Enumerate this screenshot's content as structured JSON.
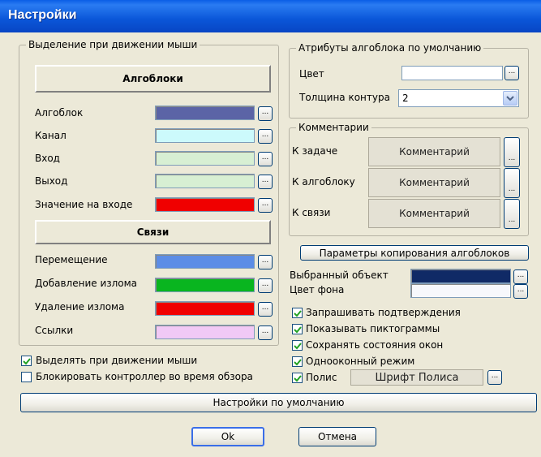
{
  "window": {
    "title": "Настройки"
  },
  "mouse_group": {
    "legend": "Выделение при движении мыши",
    "algoblocks_header": "Алгоблоки",
    "algoblock_items": [
      {
        "label": "Алгоблок",
        "color": "#5b64a6"
      },
      {
        "label": "Канал",
        "color": "#ccfafc"
      },
      {
        "label": "Вход",
        "color": "#d7efd3"
      },
      {
        "label": "Выход",
        "color": "#d7efd3"
      },
      {
        "label": "Значение на входе",
        "color": "#f00000"
      }
    ],
    "links_header": "Связи",
    "link_items": [
      {
        "label": "Перемещение",
        "color": "#5c8de6"
      },
      {
        "label": "Добавление излома",
        "color": "#09b51f"
      },
      {
        "label": "Удаление излома",
        "color": "#f00000"
      },
      {
        "label": "Ссылки",
        "color": "#f1c9f6"
      }
    ]
  },
  "attributes": {
    "legend": "Атрибуты алгоблока по умолчанию",
    "color_label": "Цвет",
    "thickness_label": "Толщина контура",
    "thickness_value": "2"
  },
  "comments": {
    "legend": "Комментарии",
    "items": [
      {
        "label": "К задаче",
        "button": "Комментарий"
      },
      {
        "label": "К алгоблоку",
        "button": "Комментарий"
      },
      {
        "label": "К связи",
        "button": "Комментарий"
      }
    ]
  },
  "copy_params_button": "Параметры копирования алгоблоков",
  "selected_object": {
    "label": "Выбранный объект",
    "color": "#102a66"
  },
  "bg_color": {
    "label": "Цвет фона",
    "color": "#f7f8fc"
  },
  "right_checkboxes": [
    {
      "label": "Запрашивать подтверждения",
      "checked": true
    },
    {
      "label": "Показывать пиктограммы",
      "checked": true
    },
    {
      "label": "Сохранять состояния окон",
      "checked": true
    },
    {
      "label": "Однооконный режим",
      "checked": true
    }
  ],
  "polis": {
    "label": "Полис",
    "checked": true,
    "font_button": "Шрифт Полиса"
  },
  "left_checkboxes": [
    {
      "label": "Выделять при движении мыши",
      "checked": true
    },
    {
      "label": "Блокировать контроллер во время обзора",
      "checked": false
    }
  ],
  "defaults_button": "Настройки по умолчанию",
  "ok_button": "Ok",
  "cancel_button": "Отмена",
  "dots_label": "...",
  "colors": {
    "title_bar": "#0a5ee6",
    "dialog_bg": "#ece9d8",
    "check_mark": "#21a121"
  }
}
